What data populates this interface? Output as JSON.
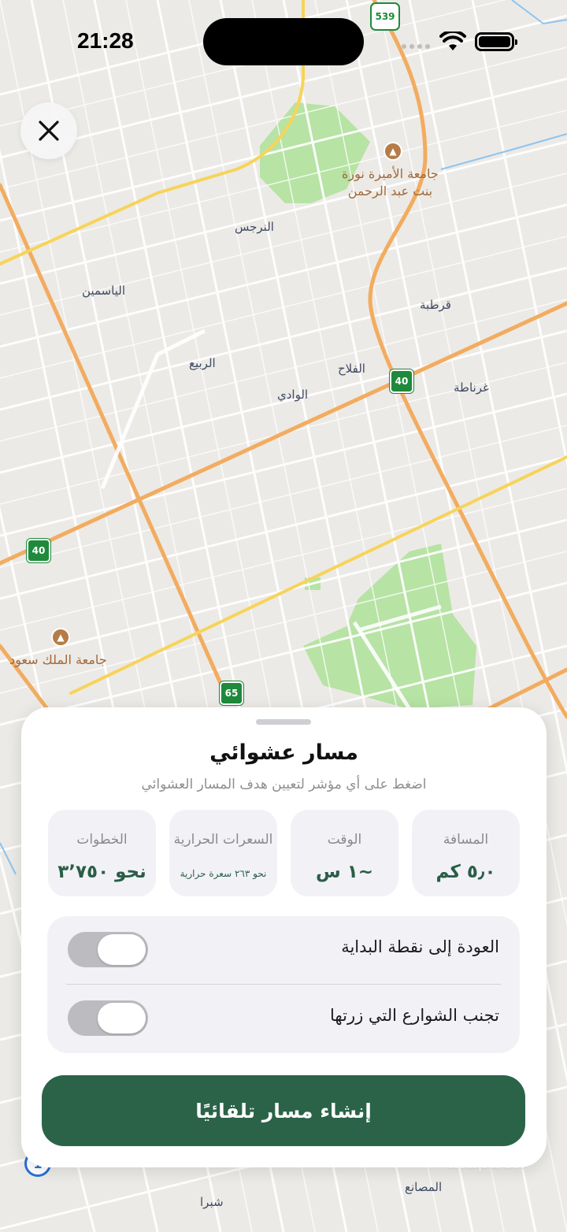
{
  "status_bar": {
    "time": "21:28"
  },
  "map": {
    "labels": {
      "narjis": "النرجس",
      "yasmin": "الياسمين",
      "rabie": "الربيع",
      "wadi": "الوادي",
      "falah": "الفلاح",
      "qurtuba": "قرطبة",
      "ghirnata": "غرناطة",
      "masani": "المصانع",
      "shubra": "شبرا"
    },
    "pois": {
      "pnu_line1": "جامعة الأميرة نورة",
      "pnu_line2": "بنت عبد الرحمن",
      "ksu": "جامعة الملك سعود"
    },
    "shields": {
      "s539": "539",
      "s40a": "40",
      "s40b": "40",
      "s65": "65"
    },
    "attribution": "mapbox"
  },
  "close_button": {
    "icon": "close-icon"
  },
  "sheet": {
    "title": "مسار عشوائي",
    "subtitle": "اضغط على أي مؤشر لتعيين هدف المسار العشوائي",
    "stats": {
      "distance": {
        "label": "المسافة",
        "value": "٥٫٠ كم"
      },
      "time": {
        "label": "الوقت",
        "value": "~١ س"
      },
      "calories": {
        "label": "السعرات الحرارية",
        "value": "نحو ٢٦٣ سعرة حرارية"
      },
      "steps": {
        "label": "الخطوات",
        "value": "نحو ٣٬٧٥٠"
      }
    },
    "toggles": {
      "return_to_start": {
        "label": "العودة إلى نقطة البداية",
        "on": false
      },
      "avoid_visited": {
        "label": "تجنب الشوارع التي زرتها",
        "on": false
      }
    },
    "cta_label": "إنشاء مسار تلقائيًا"
  },
  "colors": {
    "accent": "#2b6349",
    "value_text": "#2a5e46"
  }
}
